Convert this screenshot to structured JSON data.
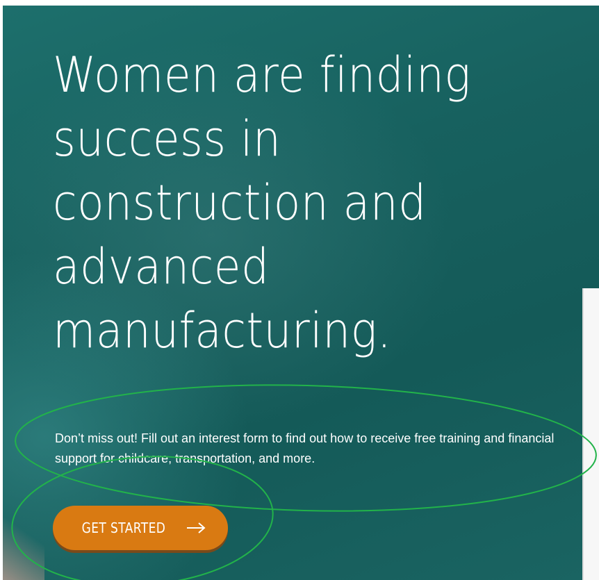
{
  "hero": {
    "headline": "Women are finding success in construction and advanced manufacturing.",
    "subtext": "Don’t miss out! Fill out an interest form to find out how to receive free training and financial support for childcare, transportation, and more.",
    "cta": {
      "label": "GET STARTED",
      "icon": "arrow-right-icon"
    }
  },
  "colors": {
    "hero_background": "#17615f",
    "cta_background": "#d97a12",
    "annotation_outline": "#22b34a",
    "text": "#ffffff"
  }
}
